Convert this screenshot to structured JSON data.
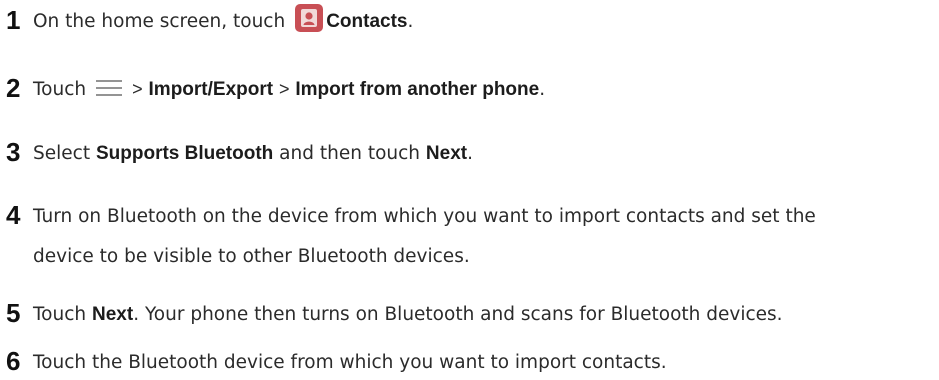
{
  "steps": [
    {
      "number": "1",
      "parts": [
        "On the home screen, touch",
        "Contacts",
        "."
      ],
      "icon": "contacts-icon",
      "icon_color": "#c84f55"
    },
    {
      "number": "2",
      "parts": [
        "Touch",
        ">",
        "Import/Export",
        ">",
        "Import from another phone",
        "."
      ],
      "icon": "menu-icon"
    },
    {
      "number": "3",
      "parts": [
        "Select",
        "Supports Bluetooth",
        "and then touch",
        "Next",
        "."
      ]
    },
    {
      "number": "4",
      "lines": [
        "Turn on Bluetooth on the device from which you want to import contacts and set the",
        "device to be visible to other Bluetooth devices."
      ]
    },
    {
      "number": "5",
      "parts": [
        "Touch",
        "Next",
        ". Your phone then turns on Bluetooth and scans for Bluetooth devices."
      ]
    },
    {
      "number": "6",
      "parts": [
        "Touch the Bluetooth device from which you want to import contacts."
      ]
    }
  ]
}
